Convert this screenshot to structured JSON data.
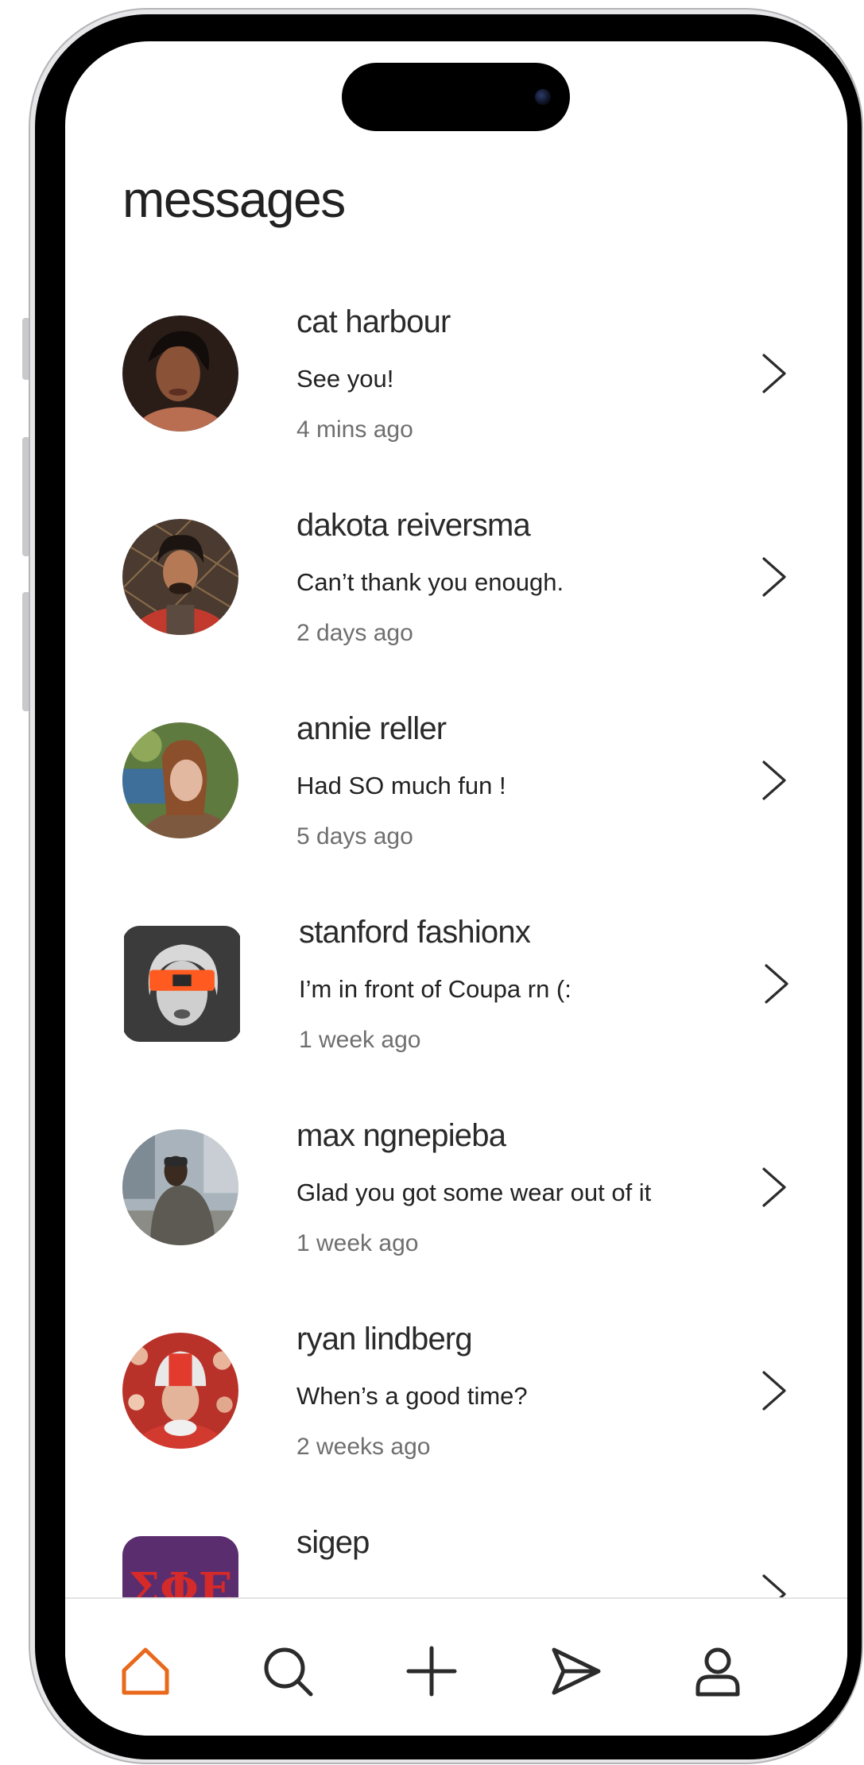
{
  "header": {
    "title": "messages"
  },
  "conversations": [
    {
      "name": "cat harbour",
      "preview": "See you!",
      "time": "4 mins ago"
    },
    {
      "name": "dakota reiversma",
      "preview": "Can’t thank you enough.",
      "time": "2 days ago"
    },
    {
      "name": "annie reller",
      "preview": "Had SO much fun !",
      "time": "5 days ago"
    },
    {
      "name": "stanford fashionx",
      "preview": "I’m in front of Coupa rn (:",
      "time": "1 week ago"
    },
    {
      "name": "max ngnepieba",
      "preview": "Glad you got some wear out of it",
      "time": "1 week ago"
    },
    {
      "name": "ryan lindberg",
      "preview": "When’s a good time?",
      "time": "2 weeks ago"
    },
    {
      "name": "sigep",
      "avatar_text": "ΣΦΕ"
    }
  ],
  "tabbar": {
    "items": [
      "home-icon",
      "search-icon",
      "plus-icon",
      "send-icon",
      "profile-icon"
    ],
    "active": "home-icon"
  },
  "colors": {
    "accent": "#E8691B",
    "icon": "#2b2b2b",
    "sigep_bg": "#5a2d6e",
    "sigep_text": "#d42a2a"
  }
}
